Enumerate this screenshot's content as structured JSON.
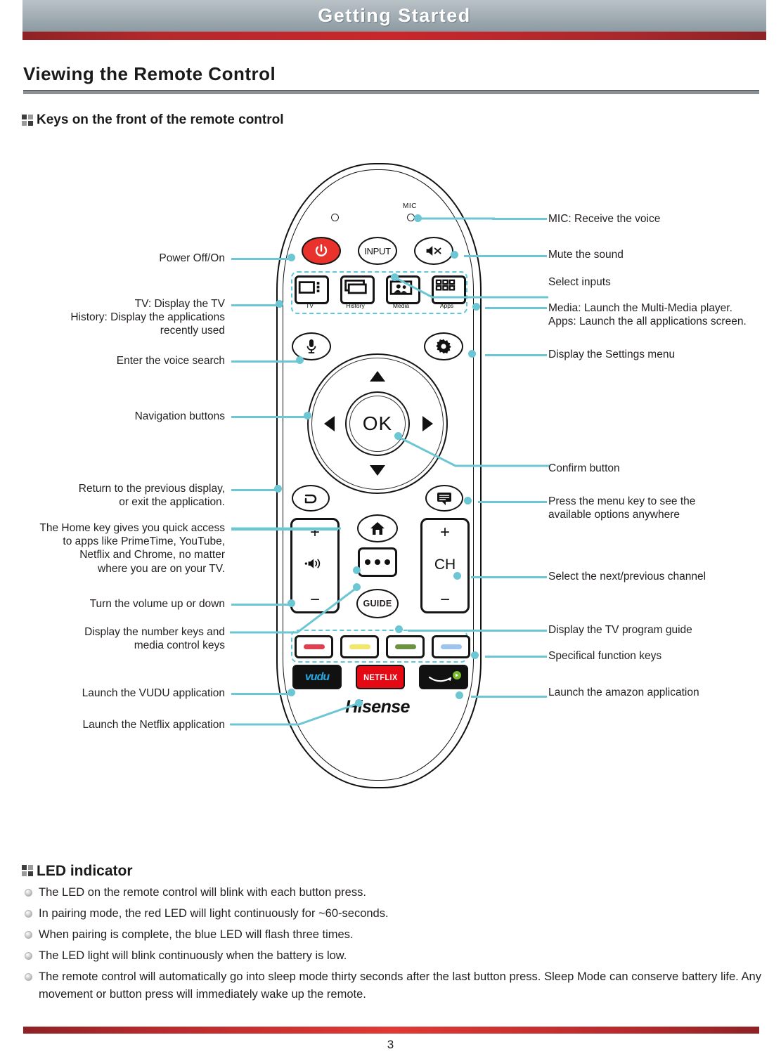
{
  "header": {
    "title": "Getting Started"
  },
  "section": {
    "title": "Viewing the Remote Control"
  },
  "subheads": {
    "keys": "Keys on the front of the remote control",
    "led": "LED indicator"
  },
  "remote": {
    "mic_label": "MIC",
    "power_icon": "power-icon",
    "input_label": "INPUT",
    "mute_icon": "mute-icon",
    "app_keys": [
      {
        "label": "TV",
        "icon": "tv-icon"
      },
      {
        "label": "History",
        "icon": "history-icon"
      },
      {
        "label": "Media",
        "icon": "media-icon"
      },
      {
        "label": "Apps",
        "icon": "apps-grid-icon"
      }
    ],
    "voice_icon": "microphone-icon",
    "settings_icon": "gear-icon",
    "ok_label": "OK",
    "back_icon": "back-arrow-icon",
    "menu_icon": "menu-bubble-icon",
    "home_icon": "home-icon",
    "dots_icon": "more-dots-icon",
    "guide_label": "GUIDE",
    "volume": {
      "plus": "+",
      "minus": "−",
      "icon": "speaker-icon"
    },
    "channel": {
      "plus": "+",
      "minus": "−",
      "label": "CH"
    },
    "color_keys": [
      {
        "name": "red-function-key",
        "color": "#e04050"
      },
      {
        "name": "yellow-function-key",
        "color": "#f2e76a"
      },
      {
        "name": "green-function-key",
        "color": "#6c9440"
      },
      {
        "name": "blue-function-key",
        "color": "#9cc4ee"
      }
    ],
    "app_buttons": [
      {
        "name": "vudu-button",
        "label": "vudu",
        "bg": "#111111",
        "fg": "#29a8df"
      },
      {
        "name": "netflix-button",
        "label": "NETFLIX",
        "bg": "#e50914",
        "fg": "#ffffff"
      },
      {
        "name": "amazon-button",
        "label": "amazon",
        "bg": "#111111",
        "fg": "#ffffff"
      }
    ],
    "brand": "Hisense"
  },
  "callouts_left": [
    {
      "name": "callout-power",
      "text": "Power Off/On"
    },
    {
      "name": "callout-tv-history",
      "text": "TV: Display the TV\nHistory: Display the applications\nrecently used"
    },
    {
      "name": "callout-voice-search",
      "text": "Enter the voice search"
    },
    {
      "name": "callout-navigation",
      "text": "Navigation buttons"
    },
    {
      "name": "callout-back",
      "text": "Return to the previous display,\nor exit the application."
    },
    {
      "name": "callout-home",
      "text": "The Home key gives you quick access\nto apps like PrimeTime,  YouTube,\nNetflix and Chrome, no matter\nwhere you are on your TV."
    },
    {
      "name": "callout-volume",
      "text": "Turn the volume up or down"
    },
    {
      "name": "callout-number-media",
      "text": "Display the number keys and\nmedia control keys"
    },
    {
      "name": "callout-vudu",
      "text": "Launch the VUDU application"
    },
    {
      "name": "callout-netflix",
      "text": "Launch the Netflix application"
    }
  ],
  "callouts_right": [
    {
      "name": "callout-mic",
      "text": "MIC: Receive the voice"
    },
    {
      "name": "callout-mute",
      "text": "Mute the sound"
    },
    {
      "name": "callout-inputs",
      "text": "Select inputs"
    },
    {
      "name": "callout-media-apps",
      "text": "Media: Launch the Multi-Media player.\nApps: Launch the all applications screen."
    },
    {
      "name": "callout-settings",
      "text": "Display the Settings menu"
    },
    {
      "name": "callout-confirm",
      "text": "Confirm button"
    },
    {
      "name": "callout-menu",
      "text": "Press the menu key to see the\navailable options anywhere"
    },
    {
      "name": "callout-channel",
      "text": "Select the next/previous channel"
    },
    {
      "name": "callout-guide",
      "text": "Display the TV program guide"
    },
    {
      "name": "callout-function-keys",
      "text": "Specifical function keys"
    },
    {
      "name": "callout-amazon",
      "text": "Launch the amazon application"
    }
  ],
  "led_items": [
    "The LED on the remote control will blink with each button press.",
    "In pairing mode, the red LED will light continuously for ~60-seconds.",
    "When pairing is complete, the blue LED will flash three times.",
    "The LED light will blink continuously when the battery is low.",
    "The remote control will automatically go into sleep mode thirty seconds after the last button press. Sleep Mode can conserve battery life. Any movement or button press will immediately wake up the remote."
  ],
  "footer": {
    "page_number": "3"
  },
  "colors": {
    "header_red": "#b4292c",
    "accent_teal": "#6cc6d4",
    "power_red": "#e8322b",
    "netflix_red": "#e50914"
  }
}
